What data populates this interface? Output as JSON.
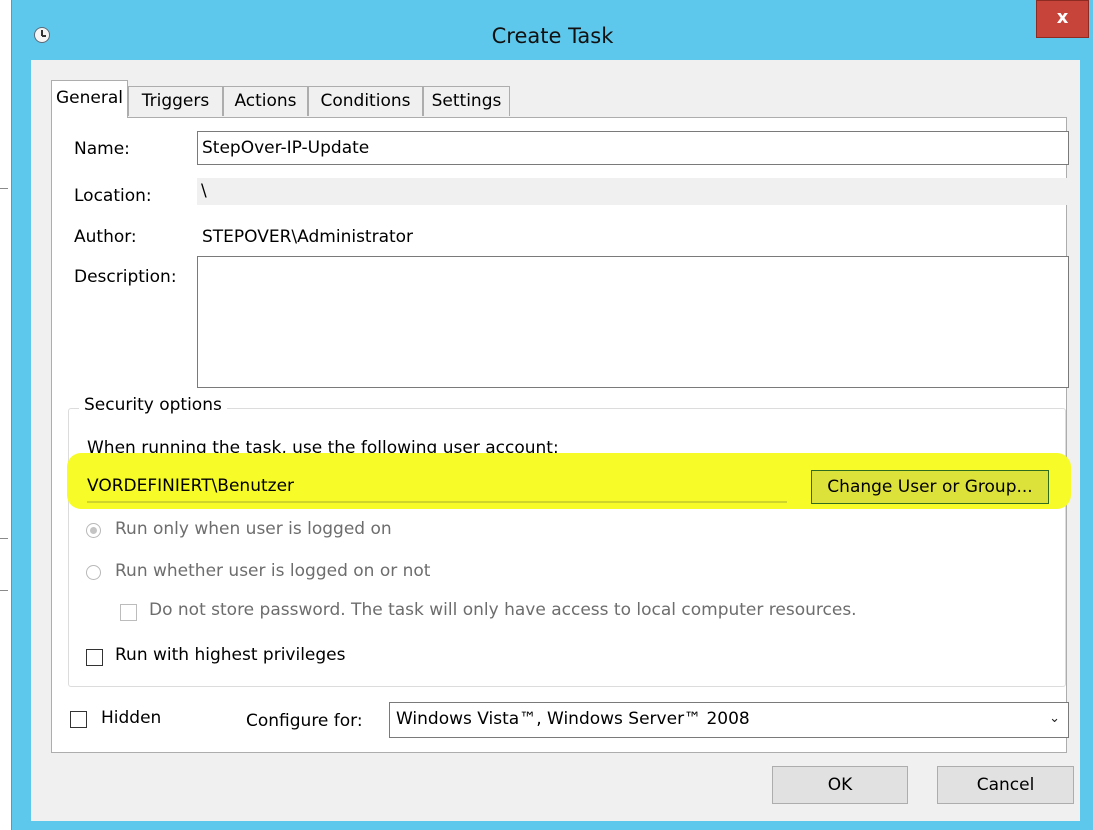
{
  "window": {
    "title": "Create Task",
    "close_glyph": "x",
    "icon": "clock-icon"
  },
  "tabs": [
    {
      "label": "General",
      "active": true
    },
    {
      "label": "Triggers",
      "active": false
    },
    {
      "label": "Actions",
      "active": false
    },
    {
      "label": "Conditions",
      "active": false
    },
    {
      "label": "Settings",
      "active": false
    }
  ],
  "general": {
    "name_label": "Name:",
    "name_value": "StepOver-IP-Update",
    "location_label": "Location:",
    "location_value": "\\",
    "author_label": "Author:",
    "author_value": "STEPOVER\\Administrator",
    "description_label": "Description:",
    "description_value": ""
  },
  "security": {
    "title": "Security options",
    "prompt": "When running the task, use the following user account:",
    "account": "VORDEFINIERT\\Benutzer",
    "change_button": "Change User or Group...",
    "highlight_color": "#f7fb27",
    "radio_logged_on": "Run only when user is logged on",
    "radio_whether": "Run whether user is logged on or not",
    "no_store_password": "Do not store password.  The task will only have access to local computer resources.",
    "highest_privileges": "Run with highest privileges"
  },
  "footer": {
    "hidden_label": "Hidden",
    "configure_label": "Configure for:",
    "configure_value": "Windows Vista™, Windows Server™ 2008",
    "ok": "OK",
    "cancel": "Cancel"
  },
  "colors": {
    "titlebar": "#5ec8ec",
    "close": "#c7443a"
  }
}
